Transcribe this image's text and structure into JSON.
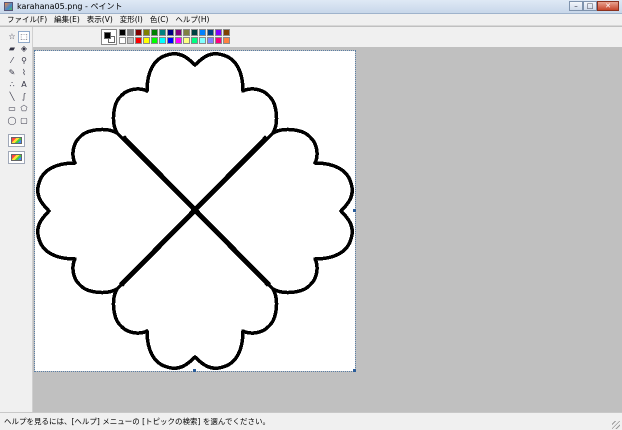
{
  "window": {
    "title": "karahana05.png - ペイント",
    "buttons": {
      "minimize": "–",
      "maximize": "□",
      "close": "✕"
    }
  },
  "menu": [
    "ファイル(F)",
    "編集(E)",
    "表示(V)",
    "変形(I)",
    "色(C)",
    "ヘルプ(H)"
  ],
  "toolbox": {
    "tools": [
      {
        "name": "free-select",
        "glyph": "☆"
      },
      {
        "name": "select",
        "glyph": "⬚"
      },
      {
        "name": "eraser",
        "glyph": "▰"
      },
      {
        "name": "fill",
        "glyph": "◈"
      },
      {
        "name": "pick-color",
        "glyph": "⁄"
      },
      {
        "name": "magnifier",
        "glyph": "⚲"
      },
      {
        "name": "pencil",
        "glyph": "✎"
      },
      {
        "name": "brush",
        "glyph": "⌇"
      },
      {
        "name": "airbrush",
        "glyph": "∴"
      },
      {
        "name": "text",
        "glyph": "A"
      },
      {
        "name": "line",
        "glyph": "╲"
      },
      {
        "name": "curve",
        "glyph": "∫"
      },
      {
        "name": "rectangle",
        "glyph": "▭"
      },
      {
        "name": "polygon",
        "glyph": "⬠"
      },
      {
        "name": "ellipse",
        "glyph": "◯"
      },
      {
        "name": "rounded-rectangle",
        "glyph": "▢"
      }
    ]
  },
  "palette": {
    "foreground": "#000000",
    "background": "#ffffff",
    "colors": [
      "#000000",
      "#808080",
      "#800000",
      "#808000",
      "#008000",
      "#008080",
      "#000080",
      "#800080",
      "#808040",
      "#004040",
      "#0080ff",
      "#004080",
      "#8000ff",
      "#804000",
      "#ffffff",
      "#c0c0c0",
      "#ff0000",
      "#ffff00",
      "#00ff00",
      "#00ffff",
      "#0000ff",
      "#ff00ff",
      "#ffff80",
      "#00ff80",
      "#80ffff",
      "#8080ff",
      "#ff0080",
      "#ff8040"
    ]
  },
  "status": {
    "message": "ヘルプを見るには、[ヘルプ] メニューの [トピックの検索] を選んでください。"
  }
}
